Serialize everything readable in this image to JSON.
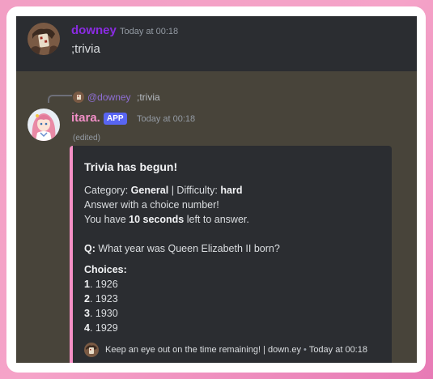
{
  "message1": {
    "username": "downey",
    "timestamp": "Today at 00:18",
    "content": ";trivia",
    "username_color": "#8a2be2"
  },
  "message2": {
    "reply": {
      "username": "@downey",
      "content": ";trivia"
    },
    "username": "itara.",
    "badge": "APP",
    "timestamp": "Today at 00:18",
    "edited": "(edited)",
    "username_color": "#f28fc7",
    "embed": {
      "accent_color": "#f48fc5",
      "title": "Trivia has begun!",
      "category_label": "Category: ",
      "category_value": "General",
      "difficulty_label": " | Difficulty: ",
      "difficulty_value": "hard",
      "instruction": "Answer with a choice number!",
      "time_prefix": "You have ",
      "time_value": "10 seconds",
      "time_suffix": " left to answer.",
      "question_label": "Q:",
      "question": " What year was Queen Elizabeth II born?",
      "choices_header": "Choices:",
      "choices": [
        {
          "num": "1",
          "text": ". 1926"
        },
        {
          "num": "2",
          "text": ". 1923"
        },
        {
          "num": "3",
          "text": ". 1930"
        },
        {
          "num": "4",
          "text": ". 1929"
        }
      ],
      "footer_text": "Keep an eye out on the time remaining! | down.ey",
      "footer_sep": "•",
      "footer_timestamp": "Today at 00:18"
    }
  }
}
